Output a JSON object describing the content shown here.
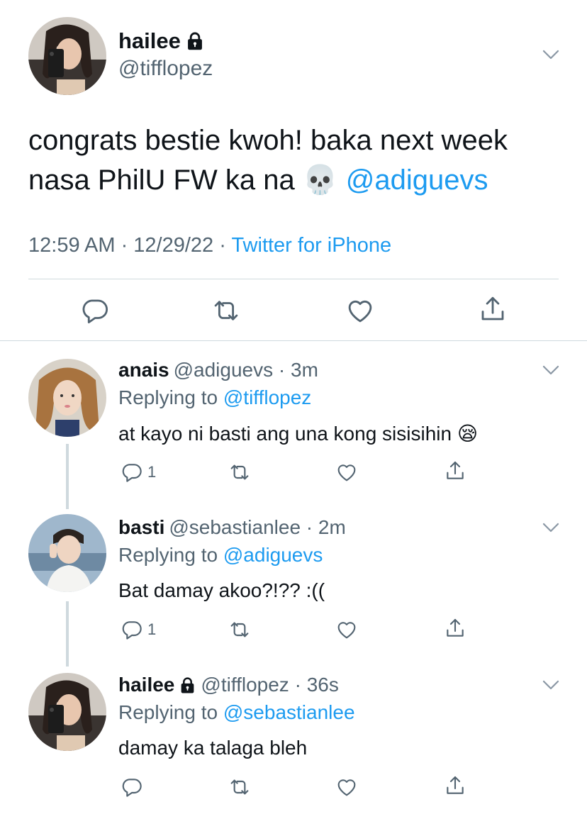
{
  "main_tweet": {
    "name": "hailee",
    "handle": "@tifflopez",
    "text_part1": "congrats bestie kwoh! baka next week nasa PhilU FW ka na ",
    "emoji": "💀",
    "mention": "@adiguevs",
    "time": "12:59 AM · 12/29/22 · ",
    "source": "Twitter for iPhone"
  },
  "replies": [
    {
      "name": "anais",
      "handle_time": "@adiguevs · 3m",
      "replying_prefix": "Replying to ",
      "replying_to": "@tifflopez",
      "text": "at kayo ni basti ang una kong sisisihin ",
      "emoji": "😪",
      "reply_count": "1"
    },
    {
      "name": "basti",
      "handle_time": "@sebastianlee · 2m",
      "replying_prefix": "Replying to ",
      "replying_to": "@adiguevs",
      "text": "Bat damay akoo?!?? :((",
      "reply_count": "1"
    },
    {
      "name": "hailee",
      "handle_time": "@tifflopez · 36s",
      "replying_prefix": "Replying to ",
      "replying_to": "@sebastianlee",
      "text": "damay ka talaga bleh",
      "reply_count": ""
    }
  ],
  "colors": {
    "text": "#0f1419",
    "secondary": "#536471",
    "accent": "#1d9bf0",
    "divider": "#cfd9de"
  },
  "icons": [
    "lock-icon",
    "chevron-down-icon",
    "reply-icon",
    "retweet-icon",
    "like-icon",
    "share-icon"
  ]
}
